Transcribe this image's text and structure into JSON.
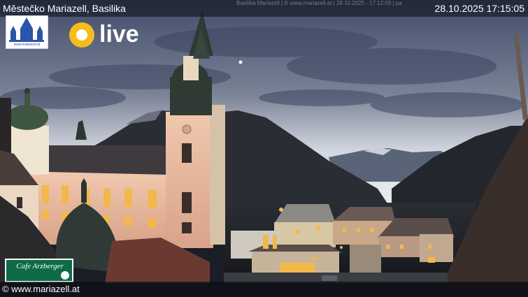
{
  "webcam": {
    "title": "Městečko Mariazell, Basilika",
    "overlay_text": "Basilika Mariazell | © www.mariazell.at | 28.10.2025 - 17:12:09 | pa",
    "timestamp": "28.10.2025 17:15:05",
    "credit": "© www.mariazell.at"
  },
  "logos": {
    "mariazell": {
      "icon": "basilica-towers-icon",
      "url_text": "www.mariazell.at"
    },
    "live": {
      "icon": "sun-icon",
      "label": "live",
      "color": "#f5bc1c"
    },
    "sponsor": {
      "name": "Cafe Arzberger",
      "icon": "crest-icon",
      "color": "#0d6b45"
    }
  },
  "colors": {
    "sky_top": "#4a5573",
    "sky_horizon": "#e4e7ec",
    "facade": "#e8b496",
    "lit_window": "#f2b84a"
  }
}
